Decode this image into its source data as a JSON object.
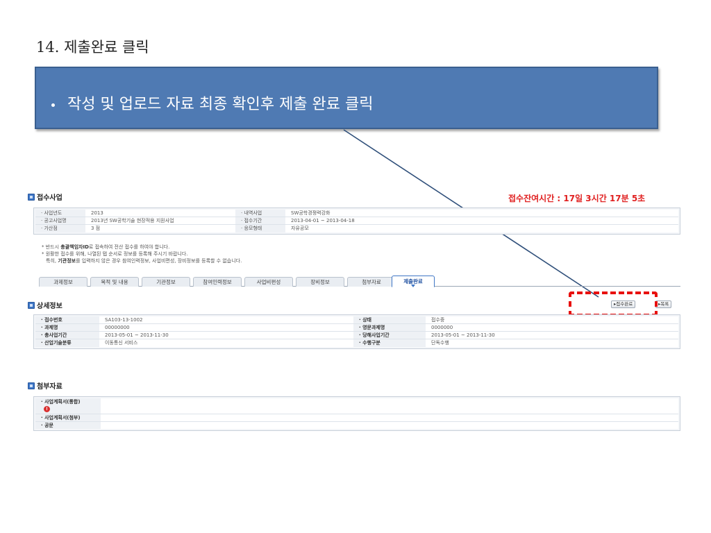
{
  "slide": {
    "title": "14.  제출완료 클릭",
    "callout": "작성 및 업로드 자료 최종 확인후 제출 완료 클릭"
  },
  "reception": {
    "section_title": "접수사업",
    "timer": "접수잔여시간 : 17일 3시간 17분 5초",
    "rows": [
      [
        {
          "label": "· 사업년도",
          "value": "2013"
        },
        {
          "label": "· 내역사업",
          "value": "SW공학경쟁력강화"
        }
      ],
      [
        {
          "label": "· 공고사업명",
          "value": "2013년 SW공학기술 현장적용 지원사업"
        },
        {
          "label": "· 접수기간",
          "value": "2013-04-01 ~ 2013-04-18"
        }
      ],
      [
        {
          "label": "· 가산점",
          "value": "3 점"
        },
        {
          "label": "· 응모형태",
          "value": "자유공모"
        }
      ]
    ],
    "notes": {
      "line1_a": "* 반드시 ",
      "line1_b": "총괄책임자ID",
      "line1_c": "로 접속하여 전산 접수를 하여야 합니다.",
      "line2": "* 원활한 접수를 위해, 나열된 탭 순서로 정보를 등록해 주시기 바랍니다.",
      "line3_a": "특히, ",
      "line3_b": "기관정보",
      "line3_c": "를 입력하지 않은 경우 참여인력정보, 사업비편성, 장비정보를 등록할 수 없습니다."
    }
  },
  "tabs": [
    {
      "label": "과제정보"
    },
    {
      "label": "목적 및 내용"
    },
    {
      "label": "기관정보"
    },
    {
      "label": "참여인력정보"
    },
    {
      "label": "사업비편성"
    },
    {
      "label": "장비정보"
    },
    {
      "label": "첨부자료"
    },
    {
      "label": "제출완료",
      "active": true
    }
  ],
  "detail": {
    "section_title": "상세정보",
    "submit_button": "▸접수완료",
    "list_button": "▸목록",
    "rows": [
      [
        {
          "label": "· 접수번호",
          "value": "SA103-13-1002"
        },
        {
          "label": "· 상태",
          "value": "접수중"
        }
      ],
      [
        {
          "label": "· 과제명",
          "value": "00000000"
        },
        {
          "label": "· 영문과제명",
          "value": "0000000"
        }
      ],
      [
        {
          "label": "· 총사업기간",
          "value": "2013-05-01 ~ 2013-11-30"
        },
        {
          "label": "· 당해사업기간",
          "value": "2013-05-01 ~ 2013-11-30"
        }
      ],
      [
        {
          "label": "· 산업기술분류",
          "value": "이동통신 서비스"
        },
        {
          "label": "· 수행구분",
          "value": "단독수행"
        }
      ]
    ]
  },
  "attachments": {
    "section_title": "첨부자료",
    "rows": [
      {
        "label": "· 사업계획서(통합)",
        "required": true,
        "required_glyph": "!"
      },
      {
        "label": "· 사업계획서(첨부)"
      },
      {
        "label": "· 공문"
      }
    ]
  },
  "colors": {
    "callout_bg": "#4f7ab3",
    "timer": "#e02020",
    "highlight": "#e8100e",
    "active_tab": "#3d75c5"
  }
}
